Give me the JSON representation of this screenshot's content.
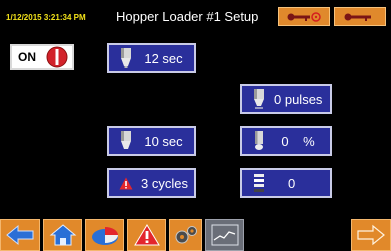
{
  "header": {
    "datetime": "1/12/2015 3:21:34 PM",
    "title": "Hopper Loader #1 Setup"
  },
  "toggle": {
    "label": "ON"
  },
  "fields": {
    "time_1": "12 sec",
    "pulses": "0 pulses",
    "time_2": "10 sec",
    "percent_value": "0",
    "percent_unit": "%",
    "cycles": "3 cycles",
    "count": "0"
  },
  "icons": {
    "header_left": "key-alarm-icon",
    "header_right": "key-icon",
    "nav": [
      "back-arrow-icon",
      "home-icon",
      "pie-chart-icon",
      "alarm-warning-icon",
      "gears-icon",
      "trend-chart-icon",
      "next-arrow-icon"
    ]
  },
  "colors": {
    "accent_orange": "#e1892a",
    "button_blue": "#2a2f9b",
    "datetime_yellow": "#f2e21a",
    "stop_red": "#d2222a"
  }
}
